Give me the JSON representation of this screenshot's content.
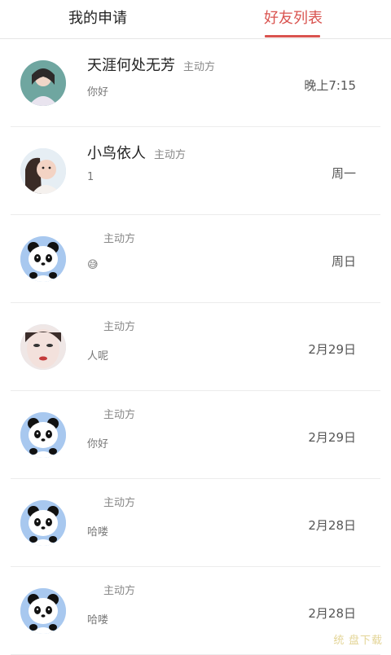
{
  "tabs": [
    {
      "label": "我的申请",
      "active": false
    },
    {
      "label": "好友列表",
      "active": true
    }
  ],
  "colors": {
    "accent": "#d9534f",
    "divider": "#ececec"
  },
  "friends": [
    {
      "name": "天涯何处无芳",
      "role": "主动方",
      "message": "你好",
      "time": "晚上7:15",
      "avatar": "photo-girl-1-avatar"
    },
    {
      "name": "小鸟依人",
      "role": "主动方",
      "message": "1",
      "time": "周一",
      "avatar": "photo-girl-2-avatar"
    },
    {
      "name": "",
      "role": "主动方",
      "message": "😅",
      "time": "周日",
      "avatar": "panda-avatar"
    },
    {
      "name": "",
      "role": "主动方",
      "message": "人呢",
      "time": "2月29日",
      "avatar": "photo-girl-3-avatar"
    },
    {
      "name": "",
      "role": "主动方",
      "message": "你好",
      "time": "2月29日",
      "avatar": "panda-avatar"
    },
    {
      "name": "",
      "role": "主动方",
      "message": "哈喽",
      "time": "2月28日",
      "avatar": "panda-avatar"
    },
    {
      "name": "",
      "role": "主动方",
      "message": "哈喽",
      "time": "2月28日",
      "avatar": "panda-avatar"
    }
  ],
  "watermark": "统 盘下载"
}
